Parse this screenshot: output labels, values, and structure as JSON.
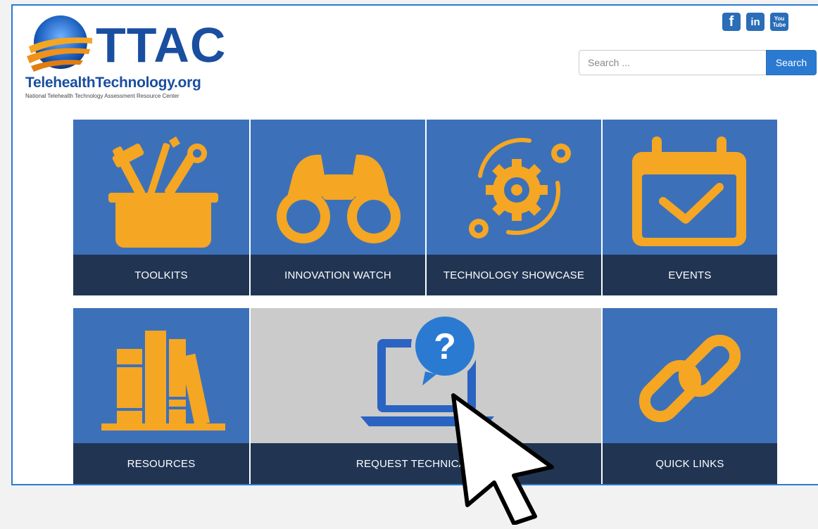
{
  "header": {
    "logo_title": "TTAC",
    "logo_site": "TelehealthTechnology.org",
    "logo_tagline": "National Telehealth Technology Assessment Resource Center"
  },
  "social": {
    "facebook": "f",
    "linkedin": "in",
    "youtube_top": "You",
    "youtube_bottom": "Tube"
  },
  "search": {
    "placeholder": "Search ...",
    "button_label": "Search"
  },
  "tiles": [
    {
      "label": "TOOLKITS",
      "icon": "toolbox-icon"
    },
    {
      "label": "INNOVATION WATCH",
      "icon": "binoculars-icon"
    },
    {
      "label": "TECHNOLOGY SHOWCASE",
      "icon": "gears-icon"
    },
    {
      "label": "EVENTS",
      "icon": "calendar-check-icon"
    },
    {
      "label": "RESOURCES",
      "icon": "books-icon"
    },
    {
      "label": "REQUEST TECHNICAL ASS",
      "icon": "laptop-question-icon"
    },
    {
      "label": "QUICK LINKS",
      "icon": "chain-link-icon"
    }
  ],
  "colors": {
    "tile_blue": "#3c71b9",
    "tile_label_bg": "#213553",
    "icon_orange": "#f5a623",
    "accent_blue": "#2a7ad2"
  }
}
